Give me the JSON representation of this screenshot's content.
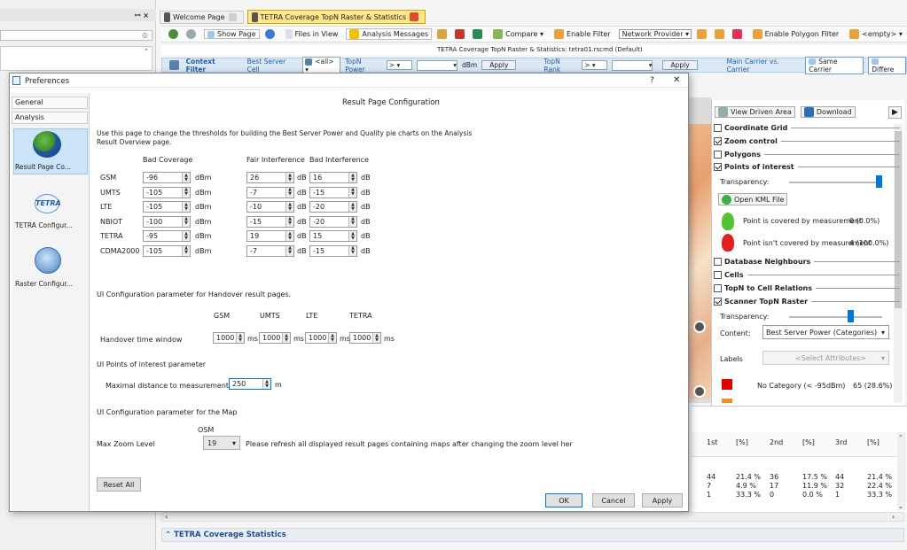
{
  "left_dock_close": "ꟷ ×",
  "tabs": [
    {
      "label": "Welcome Page"
    },
    {
      "label": "TETRA Coverage TopN Raster & Statistics"
    }
  ],
  "toolbar": {
    "show_page": "Show Page",
    "files_in_view": "Files in View",
    "analysis_messages": "Analysis Messages",
    "compare": "Compare",
    "enable_filter": "Enable Filter",
    "network_provider": "Network Provider",
    "enable_polygon_filter": "Enable Polygon Filter",
    "empty": "<empty>"
  },
  "doc_title": "TETRA Coverage TopN Raster & Statistics: tetra01.rscmd (Default)",
  "context_filter": {
    "label": "Context Filter",
    "best_server_cell": "Best Server Cell",
    "all": "<all>",
    "topn_power": "TopN Power",
    "op": ">",
    "dbm": "dBm",
    "apply": "Apply",
    "topn_rank": "TopN Rank",
    "op2": ">",
    "apply2": "Apply",
    "main_carrier": "Main Carrier vs. Carrier",
    "same_carrier": "Same Carrier",
    "different": "Differe"
  },
  "dialog": {
    "title": "Preferences",
    "help": "?",
    "close": "✕",
    "nav": {
      "general": "General",
      "analysis": "Analysis",
      "items": [
        {
          "label": "Result Page Co..."
        },
        {
          "label": "TETRA Configur..."
        },
        {
          "label": "Raster Configur..."
        }
      ],
      "tetra_logo": "TETRA"
    },
    "page_title": "Result Page Configuration",
    "intro": "Use this page to change the thresholds for building the Best Server Power and Quality pie charts on the Analysis Result Overview page.",
    "headers": {
      "bad_coverage": "Bad Coverage",
      "fair_interference": "Fair Interference",
      "bad_interference": "Bad Interference"
    },
    "unit_dbm": "dBm",
    "unit_db": "dB",
    "rows": [
      {
        "tech": "GSM",
        "bad_cov": "-96",
        "fair": "26",
        "bad_int": "16"
      },
      {
        "tech": "UMTS",
        "bad_cov": "-105",
        "fair": "-7",
        "bad_int": "-15"
      },
      {
        "tech": "LTE",
        "bad_cov": "-105",
        "fair": "-10",
        "bad_int": "-20"
      },
      {
        "tech": "NBIOT",
        "bad_cov": "-100",
        "fair": "-15",
        "bad_int": "-20"
      },
      {
        "tech": "TETRA",
        "bad_cov": "-95",
        "fair": "19",
        "bad_int": "15"
      },
      {
        "tech": "CDMA2000",
        "bad_cov": "-105",
        "fair": "-7",
        "bad_int": "-15"
      }
    ],
    "handover_title": "UI Configuration parameter for Handover result pages.",
    "handover_headers": [
      "GSM",
      "UMTS",
      "LTE",
      "TETRA"
    ],
    "handover_label": "Handover time window",
    "handover_values": [
      "1000",
      "1000",
      "1000",
      "1000"
    ],
    "unit_ms": "ms",
    "poi_title": "UI Points of interest parameter",
    "poi_label": "Maximal distance to measurement track",
    "poi_value": "250",
    "unit_m": "m",
    "map_title": "UI Configuration parameter for the Map",
    "osm": "OSM",
    "zoom_label": "Max Zoom Level",
    "zoom_value": "19",
    "zoom_note": "Please refresh all displayed result pages containing maps after changing the zoom level her",
    "reset_all": "Reset All",
    "ok": "OK",
    "cancel": "Cancel",
    "apply": "Apply"
  },
  "right_panel": {
    "view_driven_area": "View Driven Area",
    "download": "Download",
    "coordinate_grid": "Coordinate Grid",
    "zoom_control": "Zoom control",
    "polygons": "Polygons",
    "poi": "Points of interest",
    "transparency": "Transparency:",
    "open_kml": "Open KML File",
    "covered": "Point is covered by measurement",
    "covered_val": "0 (0.0%)",
    "not_covered": "Point isn't covered by measurement",
    "not_covered_val": "4 (100.0%)",
    "db_neighbours": "Database Neighbours",
    "cells": "Cells",
    "topn_cell": "TopN to Cell Relations",
    "scanner": "Scanner TopN Raster",
    "transparency2": "Transparency:",
    "content_label": "Content:",
    "content_value": "Best Server Power (Categories)",
    "labels_label": "Labels",
    "labels_value": "<Select Attributes>",
    "no_category": "No Category (< -95dBm)",
    "no_category_val": "65 (28.6%)"
  },
  "stats_table": {
    "headers": [
      "1st",
      "[%]",
      "2nd",
      "[%]",
      "3rd",
      "[%]"
    ],
    "rows": [
      [
        "44",
        "21.4 %",
        "36",
        "17.5 %",
        "44",
        "21.4 %"
      ],
      [
        "7",
        "4.9 %",
        "17",
        "11.9 %",
        "32",
        "22.4 %"
      ],
      [
        "1",
        "33.3 %",
        "0",
        "0.0 %",
        "1",
        "33.3 %"
      ]
    ]
  },
  "bottom_section": "TETRA Coverage Statistics",
  "colors": {
    "accent": "#0078d7",
    "red": "#e00000",
    "green": "#2ca02c",
    "tab_active": "#fde58c"
  }
}
